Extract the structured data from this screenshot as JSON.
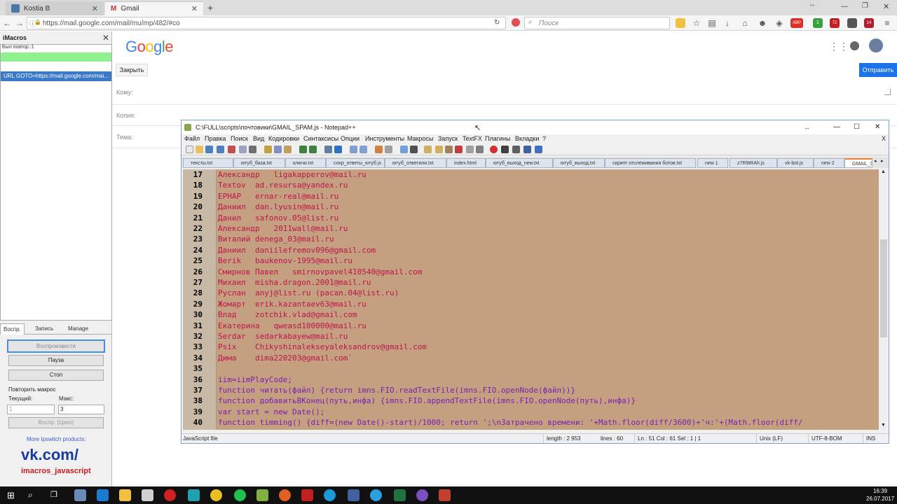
{
  "browser": {
    "tabs": [
      {
        "label": "Kostia B",
        "icon": "vk-icon"
      },
      {
        "label": "Gmail",
        "icon": "gmail-icon"
      }
    ],
    "new_tab": "+",
    "url": "https://mail.google.com/mail/mu/mp/482/#co",
    "search_placeholder": "Поиск",
    "badges": {
      "abp": "ABP",
      "green": "1",
      "count72": "72",
      "count14": "14"
    }
  },
  "imacros": {
    "title": "iMacros",
    "status": "Был повтор.:1",
    "macro": "URL GOTO=https://mail.google.com/mai...",
    "tabs": [
      "Воспр.",
      "Запись",
      "Manage"
    ],
    "play": "Воспроизвести",
    "pause": "Пауза",
    "stop": "Стоп",
    "repeat_label": "Повторить макрос",
    "current_label": "Текущий:",
    "max_label": "Макс:",
    "current_value": "1",
    "max_value": "3",
    "loop": "Воспр. (Цикл)",
    "more": "More Ipswitch products:",
    "vk": "vk.com/",
    "vk_sub": "imacros_javascript"
  },
  "gmail": {
    "logo": [
      "G",
      "o",
      "o",
      "g",
      "l",
      "e"
    ],
    "close": "Закрыть",
    "send": "Отправить",
    "to": "Кому:",
    "cc": "Копия:",
    "subject": "Тема:"
  },
  "npp": {
    "title": "C:\\FULL\\scripts\\почтовики\\GMAIL_SPAM.js - Notepad++",
    "menu": [
      "Файл",
      "Правка",
      "Поиск",
      "Вид",
      "Кодировки",
      "Синтаксисы",
      "Опции",
      "Инструменты",
      "Макросы",
      "Запуск",
      "TextFX",
      "Плагины",
      "Вкладки",
      "?"
    ],
    "menu_close": "X",
    "tabs": [
      "тексты.txt",
      "ютуб_база.txt",
      "ключи.txt",
      "сохр_ответы_ютуб.js",
      "ютуб_ответили.txt",
      "index.html",
      "ютуб_выход_new.txt",
      "ютуб_выход.txt",
      "скрипт отслеживания ботов.txt",
      "new 1",
      "z7R9tRAh.js",
      "vk-bot.js",
      "new 2",
      "GMAIL_SPAM.js"
    ],
    "lines": [
      {
        "n": "17",
        "t": "Александр   ligakapperov@mail.ru"
      },
      {
        "n": "18",
        "t": "Textov  ad.resursa@yandex.ru"
      },
      {
        "n": "19",
        "t": "ЕРНАР   ernar-real@mail.ru"
      },
      {
        "n": "20",
        "t": "Даниил  dan.lyusin@mail.ru"
      },
      {
        "n": "21",
        "t": "Данил   safonov.05@list.ru"
      },
      {
        "n": "22",
        "t": "Александр   2011wall@mail.ru"
      },
      {
        "n": "23",
        "t": "Виталий denega_03@mail.ru"
      },
      {
        "n": "24",
        "t": "Даниил  daniilefremov096@gmail.com"
      },
      {
        "n": "25",
        "t": "Berik   baukenov-1995@mail.ru"
      },
      {
        "n": "26",
        "t": "Смирнов Павел   smirnovpavel410540@gmail.com"
      },
      {
        "n": "27",
        "t": "Михаил  misha.dragon.2001@mail.ru"
      },
      {
        "n": "28",
        "t": "Руслан  anyj@list.ru (pacan.04@list.ru)"
      },
      {
        "n": "29",
        "t": "Жомарт  erik.kazantaev63@mail.ru"
      },
      {
        "n": "30",
        "t": "Влад    zotchik.vlad@gmail.com"
      },
      {
        "n": "31",
        "t": "Екатерина   qweasd100000@mail.ru"
      },
      {
        "n": "32",
        "t": "Serdar  sedarkabayew@mail.ru"
      },
      {
        "n": "33",
        "t": "Psix    Chikyshinalekseyaleksandrov@gmail.com"
      },
      {
        "n": "34",
        "t": "Дима    dima220203@gmail.com`"
      },
      {
        "n": "35",
        "t": ""
      },
      {
        "n": "36",
        "t": "iim=iimPlayCode;"
      },
      {
        "n": "37",
        "t": "function читать(файл) {return imns.FIO.readTextFile(imns.FIO.openNode(файл))}"
      },
      {
        "n": "38",
        "t": "function добавитьВКонец(путь,инфа) {imns.FIO.appendTextFile(imns.FIO.openNode(путь),инфа)}"
      },
      {
        "n": "39",
        "t": "var start = new Date();"
      },
      {
        "n": "40",
        "t": "function timming() {diff=(new Date()-start)/1000; return ';\\nЗатрачено времени: '+Math.floor(diff/3600)+'ч:'+(Math.floor(diff/"
      }
    ],
    "status": {
      "type": "JavaScript file",
      "length": "length : 2 953",
      "lines": "lines : 60",
      "pos": "Ln : 51    Col : 61    Sel : 1 | 1",
      "eol": "Unix (LF)",
      "enc": "UTF-8-BOM",
      "ins": "INS"
    }
  },
  "taskbar": {
    "time": "16:39",
    "date": "26.07.2017"
  }
}
